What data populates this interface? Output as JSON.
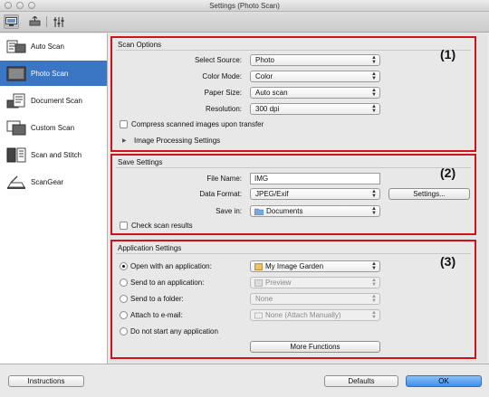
{
  "window": {
    "title": "Settings (Photo Scan)"
  },
  "toolbar": {
    "tabs": [
      {
        "name": "scan-from-computer-tab-icon",
        "active": true
      },
      {
        "name": "scan-from-operation-panel-tab-icon",
        "active": false
      },
      {
        "name": "general-settings-tab-icon",
        "active": false
      }
    ]
  },
  "sidebar": {
    "items": [
      {
        "label": "Auto Scan",
        "icon": "auto-scan-icon"
      },
      {
        "label": "Photo Scan",
        "icon": "photo-scan-icon",
        "selected": true
      },
      {
        "label": "Document Scan",
        "icon": "document-scan-icon"
      },
      {
        "label": "Custom Scan",
        "icon": "custom-scan-icon"
      },
      {
        "label": "Scan and Stitch",
        "icon": "scan-and-stitch-icon"
      },
      {
        "label": "ScanGear",
        "icon": "scangear-icon"
      }
    ]
  },
  "scan_options": {
    "title": "Scan Options",
    "marker": "(1)",
    "select_source": {
      "label": "Select Source:",
      "value": "Photo"
    },
    "color_mode": {
      "label": "Color Mode:",
      "value": "Color"
    },
    "paper_size": {
      "label": "Paper Size:",
      "value": "Auto scan"
    },
    "resolution": {
      "label": "Resolution:",
      "value": "300 dpi"
    },
    "compress_label": "Compress scanned images upon transfer",
    "image_processing_label": "Image Processing Settings"
  },
  "save_settings": {
    "title": "Save Settings",
    "marker": "(2)",
    "file_name": {
      "label": "File Name:",
      "value": "IMG"
    },
    "data_format": {
      "label": "Data Format:",
      "value": "JPEG/Exif"
    },
    "settings_button": "Settings...",
    "save_in": {
      "label": "Save in:",
      "value": "Documents"
    },
    "check_results_label": "Check scan results"
  },
  "app_settings": {
    "title": "Application Settings",
    "marker": "(3)",
    "open_with": {
      "label": "Open with an application:",
      "value": "My Image Garden"
    },
    "send_to_app": {
      "label": "Send to an application:",
      "value": "Preview"
    },
    "send_to_folder": {
      "label": "Send to a folder:",
      "value": "None"
    },
    "attach_email": {
      "label": "Attach to e-mail:",
      "value": "None (Attach Manually)"
    },
    "do_not_start_label": "Do not start any application",
    "more_functions_button": "More Functions"
  },
  "footer": {
    "instructions_button": "Instructions",
    "defaults_button": "Defaults",
    "ok_button": "OK"
  },
  "colors": {
    "highlight_border": "#d0121b",
    "selection": "#3b76c4",
    "ok_button": "#3d8eeb"
  }
}
